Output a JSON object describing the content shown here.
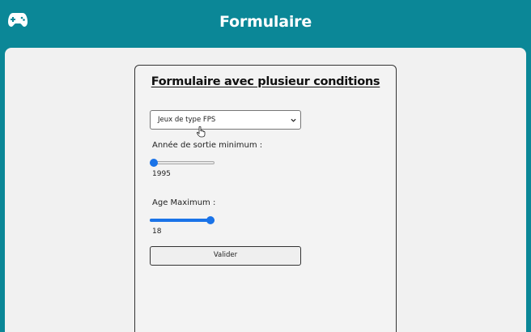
{
  "header": {
    "title": "Formulaire",
    "logo_icon": "gamepad-icon"
  },
  "form": {
    "title": "Formulaire avec plusieur conditions",
    "genre_select": {
      "selected": "Jeux de type FPS"
    },
    "min_year": {
      "label": "Année de sortie minimum :",
      "value": "1995",
      "slider_fraction": 0
    },
    "max_age": {
      "label": "Age Maximum :",
      "value": "18",
      "slider_fraction": 1
    },
    "submit_label": "Valider"
  },
  "colors": {
    "header_bg": "#0b8797",
    "accent": "#1a73e8"
  }
}
